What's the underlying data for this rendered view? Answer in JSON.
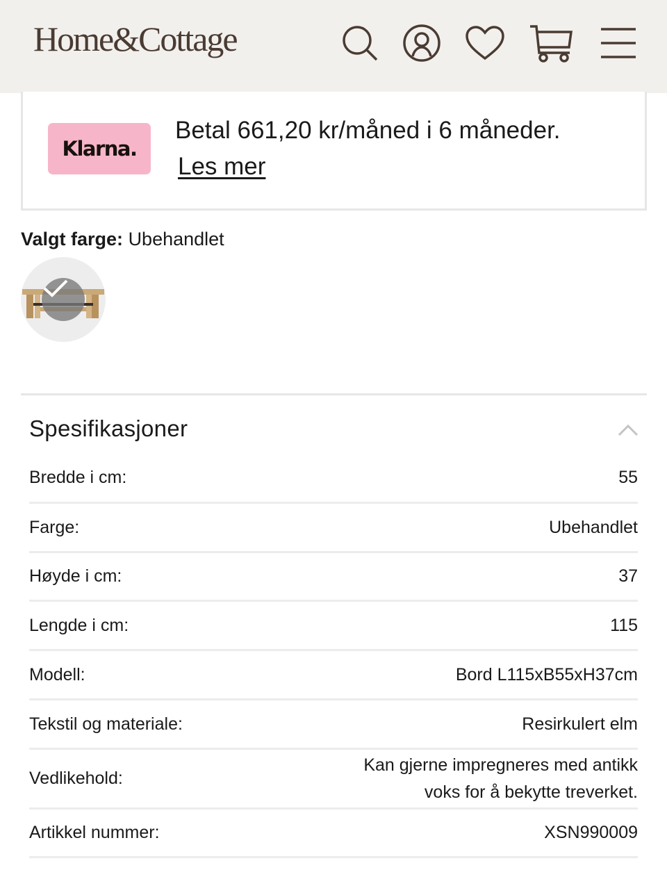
{
  "header": {
    "logo": "Home&Cottage",
    "icons": [
      "search-icon",
      "account-icon",
      "heart-icon",
      "cart-icon",
      "menu-icon"
    ]
  },
  "klarna": {
    "badge": "Klarna.",
    "text": "Betal 661,20 kr/måned i 6 måneder.",
    "link": "Les mer",
    "badge_color": "#f7b5c9"
  },
  "color_select": {
    "label": "Valgt farge:",
    "value": "Ubehandlet"
  },
  "specs": {
    "title": "Spesifikasjoner",
    "rows": [
      {
        "label": "Bredde i cm:",
        "value": "55"
      },
      {
        "label": "Farge:",
        "value": "Ubehandlet"
      },
      {
        "label": "Høyde i cm:",
        "value": "37"
      },
      {
        "label": "Lengde i cm:",
        "value": "115"
      },
      {
        "label": "Modell:",
        "value": "Bord L115xB55xH37cm"
      },
      {
        "label": "Tekstil og materiale:",
        "value": "Resirkulert elm"
      },
      {
        "label": "Vedlikehold:",
        "value": "Kan gjerne impregneres med antikk voks for å bekytte treverket."
      },
      {
        "label": "Artikkel nummer:",
        "value": "XSN990009"
      }
    ]
  },
  "colors": {
    "header_bg": "#f2f0ec",
    "brand": "#4a3b33"
  }
}
